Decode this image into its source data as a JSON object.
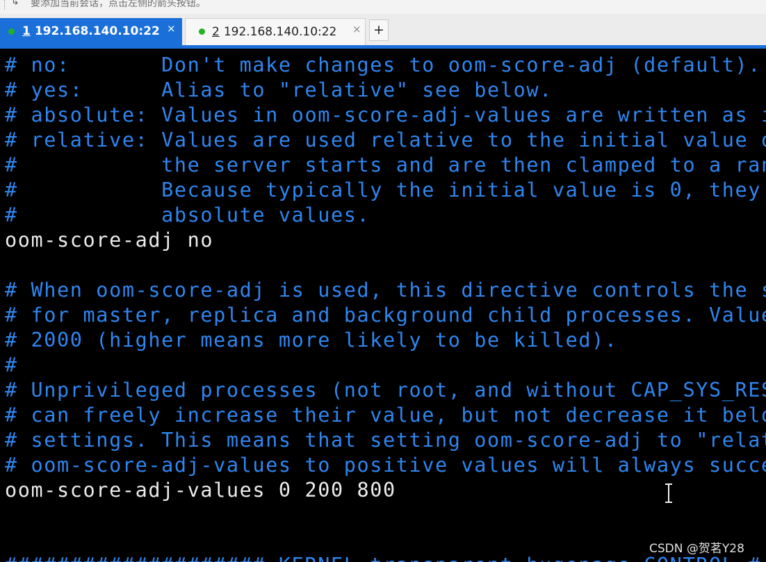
{
  "hint_bar": {
    "icon": "arrow-into-bar-icon",
    "text": "要添加当前会话，点击左侧的箭头按钮。"
  },
  "tabs": [
    {
      "number": "1",
      "title": "192.168.140.10:22",
      "status": "connected",
      "active": true,
      "close": "×"
    },
    {
      "number": "2",
      "title": "192.168.140.10:22",
      "status": "connected",
      "active": false,
      "close": "×"
    }
  ],
  "new_tab": "+",
  "colors": {
    "accent": "#1b6fd8",
    "comment": "#2f86f0",
    "directive": "#ececec",
    "status_connected": "#1fb322"
  },
  "terminal": {
    "lines": [
      {
        "type": "comment",
        "text": "# no:       Don't make changes to oom-score-adj (default)."
      },
      {
        "type": "comment",
        "text": "# yes:      Alias to \"relative\" see below."
      },
      {
        "type": "comment",
        "text": "# absolute: Values in oom-score-adj-values are written as i"
      },
      {
        "type": "comment",
        "text": "# relative: Values are used relative to the initial value o"
      },
      {
        "type": "comment",
        "text": "#           the server starts and are then clamped to a ran"
      },
      {
        "type": "comment",
        "text": "#           Because typically the initial value is 0, they"
      },
      {
        "type": "comment",
        "text": "#           absolute values."
      },
      {
        "type": "directive",
        "text": "oom-score-adj no"
      },
      {
        "type": "blank",
        "text": ""
      },
      {
        "type": "comment",
        "text": "# When oom-score-adj is used, this directive controls the s"
      },
      {
        "type": "comment",
        "text": "# for master, replica and background child processes. Value"
      },
      {
        "type": "comment",
        "text": "# 2000 (higher means more likely to be killed)."
      },
      {
        "type": "comment",
        "text": "#"
      },
      {
        "type": "comment",
        "text": "# Unprivileged processes (not root, and without CAP_SYS_RES"
      },
      {
        "type": "comment",
        "text": "# can freely increase their value, but not decrease it belo"
      },
      {
        "type": "comment",
        "text": "# settings. This means that setting oom-score-adj to \"relat"
      },
      {
        "type": "comment",
        "text": "# oom-score-adj-values to positive values will always succe"
      },
      {
        "type": "directive",
        "text": "oom-score-adj-values 0 200 800"
      },
      {
        "type": "blank",
        "text": ""
      },
      {
        "type": "blank",
        "text": ""
      },
      {
        "type": "comment",
        "text": "#################### KERNEL transparent hugepage CONTROL #"
      }
    ]
  },
  "watermark": "CSDN @贺茗Y28"
}
